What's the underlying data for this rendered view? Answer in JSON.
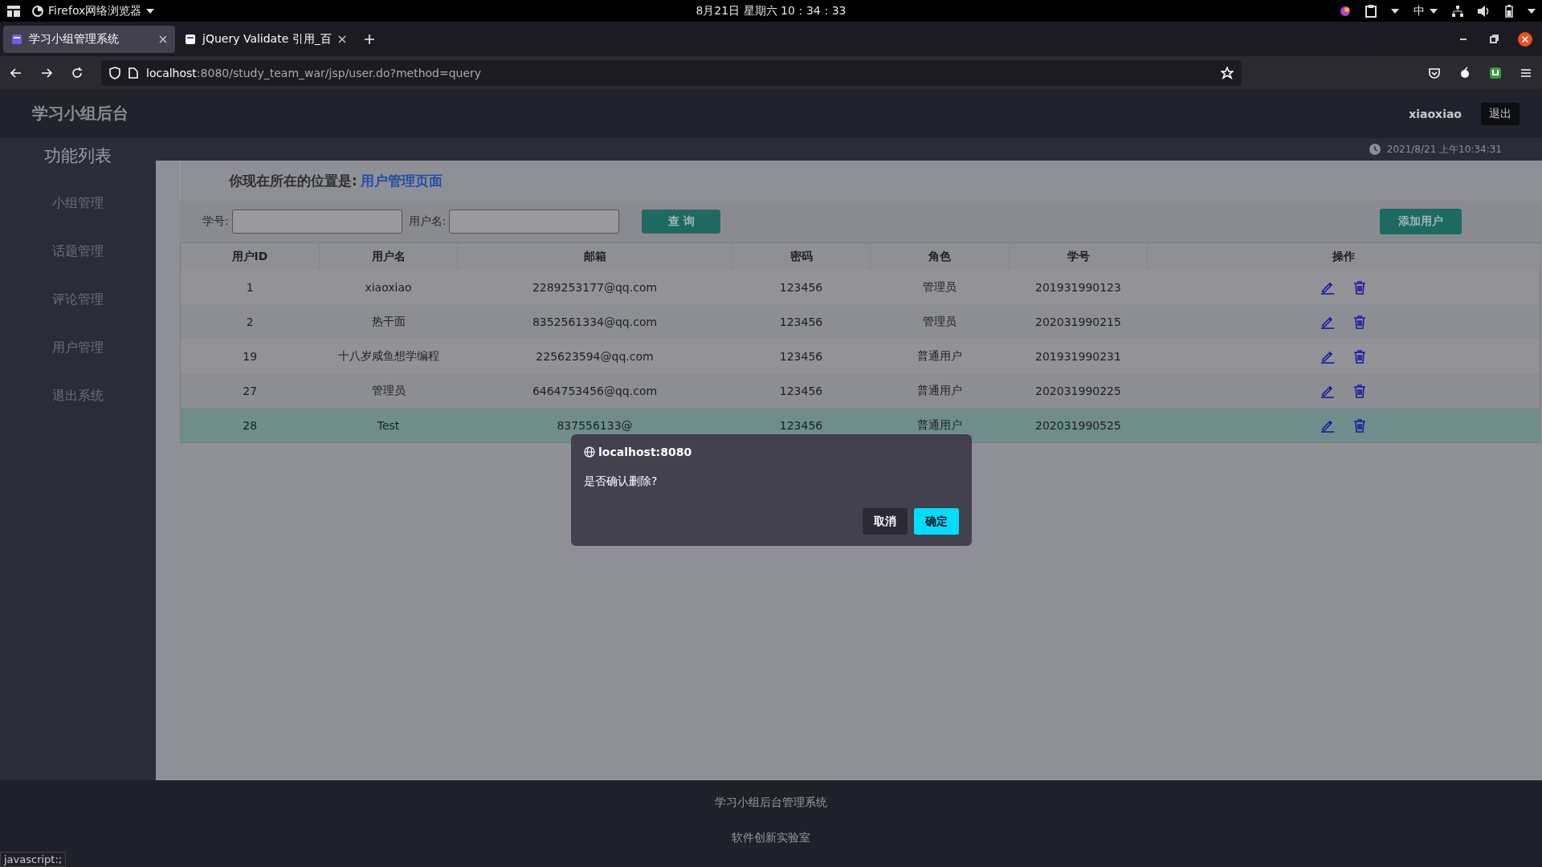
{
  "desktop_bar": {
    "app_menu": "Firefox网络浏览器",
    "clock": "8月21日 星期六 10：34：33",
    "input_method": "中"
  },
  "browser": {
    "tabs": [
      {
        "title": "学习小组管理系统",
        "selected": true
      },
      {
        "title": "jQuery Validate 引用_百",
        "selected": false
      }
    ],
    "url_host": "localhost",
    "url_rest": ":8080/study_team_war/jsp/user.do?method=query",
    "status_link": "javascript:;"
  },
  "app": {
    "brand": "学习小组后台",
    "user": "xiaoxiao",
    "logout": "退出",
    "datetime": "2021/8/21 上午10:34:31",
    "sidebar": {
      "title": "功能列表",
      "items": [
        "小组管理",
        "话题管理",
        "评论管理",
        "用户管理",
        "退出系统"
      ]
    },
    "breadcrumb": {
      "label": "你现在所在的位置是:",
      "current": "用户管理页面"
    },
    "search": {
      "fields": [
        {
          "label": "学号:"
        },
        {
          "label": "用户名:"
        }
      ],
      "button": "查 询",
      "add_button": "添加用户"
    },
    "table": {
      "columns": [
        "用户ID",
        "用户名",
        "邮箱",
        "密码",
        "角色",
        "学号",
        "操作"
      ],
      "rows": [
        {
          "cells": [
            "1",
            "xiaoxiao",
            "2289253177@qq.com",
            "123456",
            "管理员",
            "201931990123"
          ],
          "selected": false
        },
        {
          "cells": [
            "2",
            "热干面",
            "8352561334@qq.com",
            "123456",
            "管理员",
            "202031990215"
          ],
          "selected": false
        },
        {
          "cells": [
            "19",
            "十八岁咸鱼想学编程",
            "225623594@qq.com",
            "123456",
            "普通用户",
            "201931990231"
          ],
          "selected": false
        },
        {
          "cells": [
            "27",
            "管理员",
            "6464753456@qq.com",
            "123456",
            "普通用户",
            "202031990225"
          ],
          "selected": false
        },
        {
          "cells": [
            "28",
            "Test",
            "837556133@",
            "123456",
            "普通用户",
            "202031990525"
          ],
          "selected": true
        }
      ]
    },
    "footer": [
      "学习小组后台管理系统",
      "软件创新实验室"
    ]
  },
  "dialog": {
    "origin": "localhost:8080",
    "message": "是否确认删除?",
    "buttons": [
      {
        "label": "取消",
        "kind": "cancel"
      },
      {
        "label": "确定",
        "kind": "confirm"
      }
    ]
  }
}
